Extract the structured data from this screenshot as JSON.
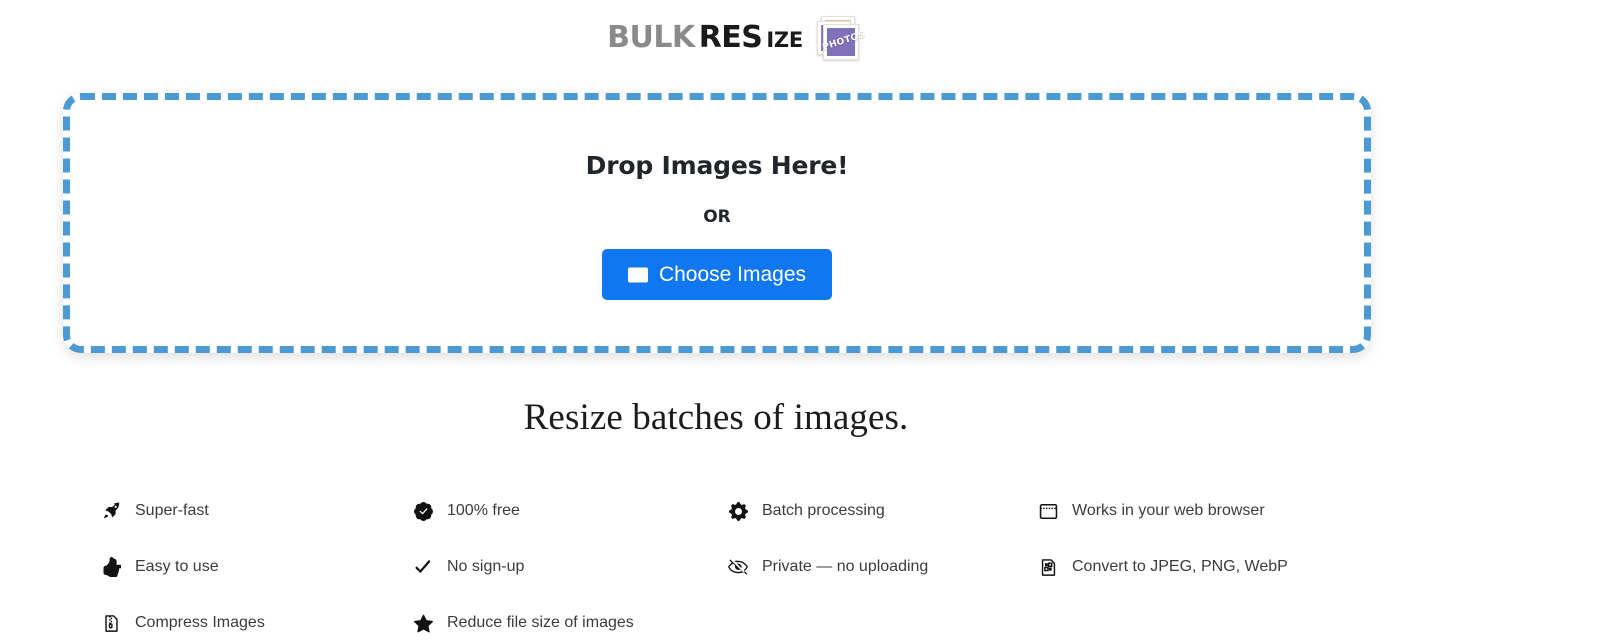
{
  "logo": {
    "bulk": "BULK",
    "res": "RES",
    "ize": "IZE",
    "photos_label": "PHOTOS",
    "icon": "stacked-photos-icon"
  },
  "dropzone": {
    "title": "Drop Images Here!",
    "or": "OR",
    "button_label": "Choose Images",
    "button_icon": "image-icon",
    "button_color": "#1177f1",
    "border_color": "#4b9ad4"
  },
  "tagline": "Resize batches of images.",
  "features": [
    {
      "icon": "rocket-icon",
      "label": "Super-fast"
    },
    {
      "icon": "patch-check-icon",
      "label": "100% free"
    },
    {
      "icon": "gear-icon",
      "label": "Batch processing"
    },
    {
      "icon": "browser-window-icon",
      "label": "Works in your web browser"
    },
    {
      "icon": "thumbs-up-icon",
      "label": "Easy to use"
    },
    {
      "icon": "check-icon",
      "label": "No sign-up"
    },
    {
      "icon": "eye-slash-icon",
      "label": "Private — no uploading"
    },
    {
      "icon": "file-binary-icon",
      "label": "Convert to JPEG, PNG, WebP"
    },
    {
      "icon": "file-zip-icon",
      "label": "Compress Images"
    },
    {
      "icon": "star-icon",
      "label": "Reduce file size of images"
    }
  ]
}
